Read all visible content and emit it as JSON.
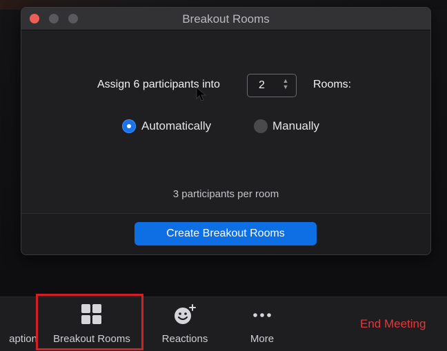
{
  "dialog": {
    "title": "Breakout Rooms",
    "assign_label": "Assign 6 participants into",
    "room_count": "2",
    "rooms_label": "Rooms:",
    "options": {
      "automatic_label": "Automatically",
      "manual_label": "Manually",
      "selected": "Automatically"
    },
    "per_room_text": "3 participants per room",
    "create_button_label": "Create Breakout Rooms"
  },
  "toolbar": {
    "captions_label": "aption",
    "breakout_label": "Breakout Rooms",
    "reactions_label": "Reactions",
    "more_label": "More",
    "end_meeting_label": "End Meeting"
  },
  "colors": {
    "accent_blue": "#0e6ee3",
    "end_meeting_red": "#e0393e",
    "highlight_red": "#d41f24"
  },
  "icons": {
    "breakout": "grid-icon",
    "reactions": "smiley-plus-icon",
    "more": "ellipsis-icon"
  }
}
